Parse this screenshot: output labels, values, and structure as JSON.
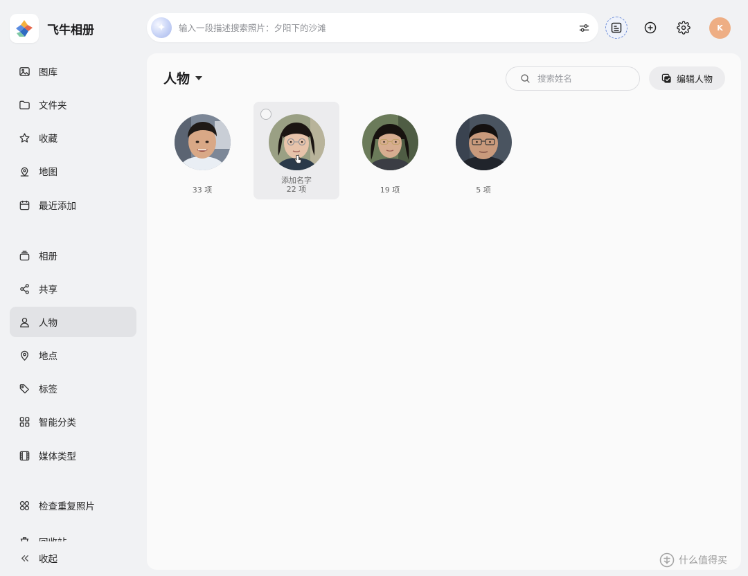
{
  "app": {
    "title": "飞牛相册"
  },
  "sidebar": {
    "items": [
      {
        "label": "图库",
        "icon": "image-icon"
      },
      {
        "label": "文件夹",
        "icon": "folder-icon"
      },
      {
        "label": "收藏",
        "icon": "star-icon"
      },
      {
        "label": "地图",
        "icon": "map-icon"
      },
      {
        "label": "最近添加",
        "icon": "calendar-icon"
      },
      {
        "label": "相册",
        "icon": "album-icon"
      },
      {
        "label": "共享",
        "icon": "share-icon"
      },
      {
        "label": "人物",
        "icon": "person-icon",
        "active": true
      },
      {
        "label": "地点",
        "icon": "location-pin-icon"
      },
      {
        "label": "标签",
        "icon": "tag-icon"
      },
      {
        "label": "智能分类",
        "icon": "grid-icon"
      },
      {
        "label": "媒体类型",
        "icon": "film-icon"
      },
      {
        "label": "检查重复照片",
        "icon": "duplicate-icon"
      },
      {
        "label": "回收站",
        "icon": "trash-icon"
      }
    ],
    "collapse_label": "收起"
  },
  "search": {
    "placeholder": "输入一段描述搜索照片：夕阳下的沙滩"
  },
  "header": {
    "avatar_initial": "K"
  },
  "main": {
    "title": "人物",
    "name_search_placeholder": "搜索姓名",
    "edit_label": "编辑人物",
    "people": [
      {
        "count": "33 项"
      },
      {
        "name": "添加名字",
        "count": "22 项"
      },
      {
        "count": "19 项"
      },
      {
        "count": "5 项"
      }
    ]
  },
  "watermark": {
    "text": "什么值得买"
  },
  "colors": {
    "accent": "#6f8ed8",
    "avatar": "#eeae84",
    "active_nav": "#e2e3e6"
  }
}
